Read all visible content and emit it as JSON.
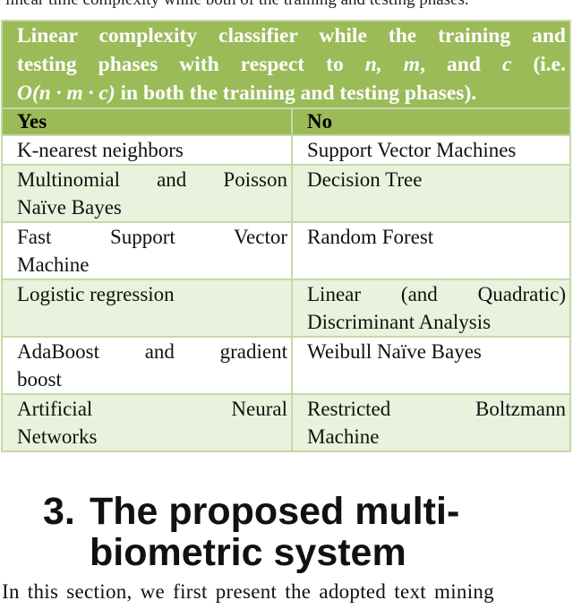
{
  "preceding_text": "linear time complexity while both of the training and testing phases.",
  "table": {
    "title_line1": "Linear complexity classifier while the training and",
    "title_line2_a": "testing phases with respect to ",
    "title_line2_vars": "n, m",
    "title_line2_b": ", and ",
    "title_line2_c": "c",
    "title_line2_d": " (i.e.",
    "title_line3_formula": "O(n · m · c)",
    "title_line3_rest": " in both the training and testing phases).",
    "headers": [
      "Yes",
      "No"
    ],
    "rows": [
      {
        "yes": "K-nearest neighbors",
        "no": "Support Vector Machines"
      },
      {
        "yes": "Multinomial and Poisson Naïve Bayes",
        "no": "Decision Tree"
      },
      {
        "yes": "Fast Support Vector Machine",
        "no": "Random Forest"
      },
      {
        "yes": "Logistic regression",
        "no": "Linear (and Quadratic) Discriminant Analysis"
      },
      {
        "yes": "AdaBoost and gradient boost",
        "no": "Weibull Naïve Bayes"
      },
      {
        "yes": "Artificial Neural Networks",
        "no": "Restricted Boltzmann Machine"
      }
    ],
    "colors": {
      "header_green": "#9bbb59",
      "alt_row": "#eaf1dd",
      "border": "#c5d9a8"
    }
  },
  "section": {
    "number": "3.",
    "title_line1": "The proposed multi-",
    "title_line2": "biometric system"
  },
  "body_text": "In this section, we first present the adopted text mining"
}
